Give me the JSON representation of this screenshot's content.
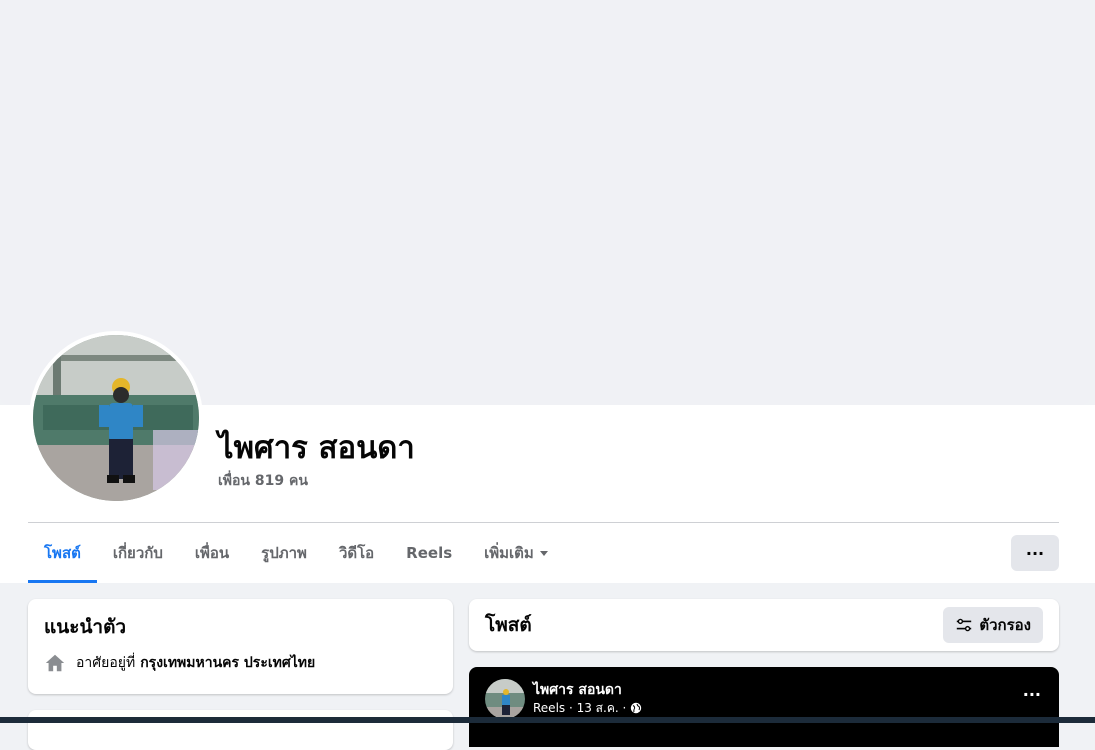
{
  "profile": {
    "name": "ไพศาร สอนดา",
    "friends": "เพื่อน 819 คน"
  },
  "tabs": [
    {
      "label": "โพสต์",
      "active": true
    },
    {
      "label": "เกี่ยวกับ"
    },
    {
      "label": "เพื่อน"
    },
    {
      "label": "รูปภาพ"
    },
    {
      "label": "วิดีโอ"
    },
    {
      "label": "Reels"
    },
    {
      "label": "เพิ่มเติม"
    }
  ],
  "more_button": "···",
  "intro": {
    "title": "แนะนำตัว",
    "lives_prefix": "อาศัยอยู่ที่",
    "location": "กรุงเทพมหานคร ประเทศไทย"
  },
  "posts": {
    "title": "โพสต์",
    "filter_label": "ตัวกรอง"
  },
  "reel_post": {
    "author": "ไพศาร สอนดา",
    "meta": "Reels · 13 ส.ค. ·",
    "more": "···"
  },
  "colors": {
    "accent": "#1877f2",
    "secondary_text": "#65676b",
    "button_bg": "#e4e6eb"
  }
}
